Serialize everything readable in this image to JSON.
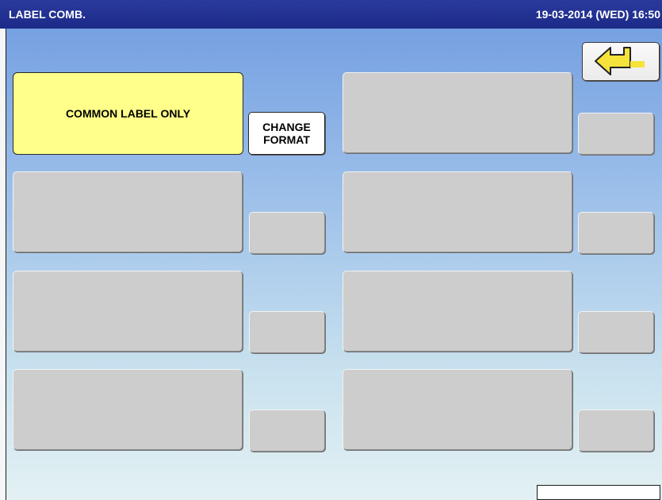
{
  "titlebar": {
    "title": "LABEL COMB.",
    "datetime": "19-03-2014 (WED)  16:50"
  },
  "buttons": {
    "common_label": "COMMON LABEL ONLY",
    "change_format_line1": "CHANGE",
    "change_format_line2": "FORMAT"
  },
  "icons": {
    "back": "return-arrow-icon"
  },
  "colors": {
    "title_bar": "#1f2d8f",
    "selected_button": "#ffff8a",
    "empty_button": "#cdcdcd",
    "return_arrow": "#f5e23a"
  }
}
